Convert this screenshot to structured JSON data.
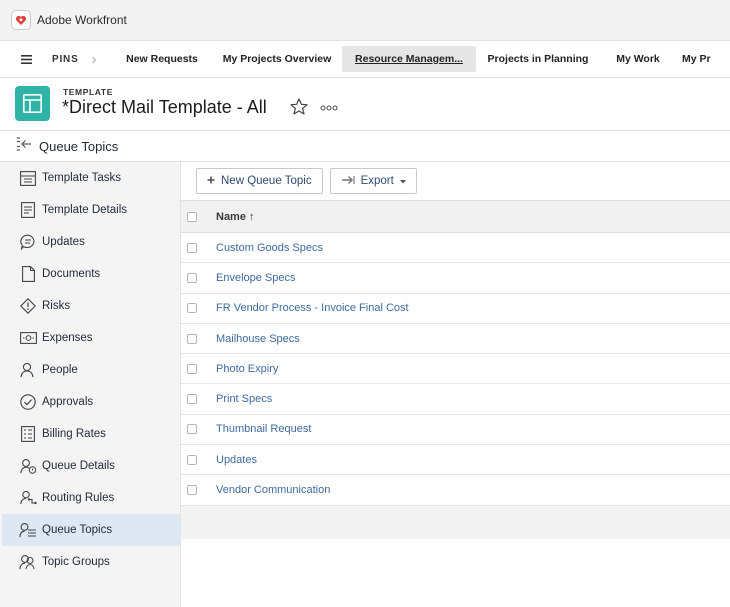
{
  "app": {
    "title": "Adobe Workfront",
    "accent": "#2fb3a6",
    "link_color": "#3d6a9f"
  },
  "nav": {
    "pins_label": "PINS",
    "tabs": [
      {
        "label": "New Requests"
      },
      {
        "label": "My Projects Overview"
      },
      {
        "label": "Resource Managem...",
        "active": true
      },
      {
        "label": "Projects in Planning"
      },
      {
        "label": "My Work"
      },
      {
        "label": "My Pr"
      }
    ]
  },
  "header": {
    "object_type": "TEMPLATE",
    "object_title": "*Direct Mail Template - All",
    "icon": "template-icon"
  },
  "section": {
    "title": "Queue Topics",
    "icon": "collapse-panel-icon"
  },
  "sidebar": {
    "items": [
      {
        "label": "Template Tasks",
        "icon": "tasks-icon"
      },
      {
        "label": "Template Details",
        "icon": "details-icon"
      },
      {
        "label": "Updates",
        "icon": "updates-icon"
      },
      {
        "label": "Documents",
        "icon": "documents-icon"
      },
      {
        "label": "Risks",
        "icon": "risks-icon"
      },
      {
        "label": "Expenses",
        "icon": "expenses-icon"
      },
      {
        "label": "People",
        "icon": "people-icon"
      },
      {
        "label": "Approvals",
        "icon": "approvals-icon"
      },
      {
        "label": "Billing Rates",
        "icon": "billing-rates-icon"
      },
      {
        "label": "Queue Details",
        "icon": "queue-details-icon"
      },
      {
        "label": "Routing Rules",
        "icon": "routing-rules-icon"
      },
      {
        "label": "Queue Topics",
        "icon": "queue-topics-icon",
        "active": true
      },
      {
        "label": "Topic Groups",
        "icon": "topic-groups-icon"
      }
    ]
  },
  "toolbar": {
    "new_label": "New Queue Topic",
    "export_label": "Export"
  },
  "grid": {
    "column_name": "Name",
    "sort_indicator": "↑",
    "rows": [
      "Custom Goods Specs",
      "Envelope Specs",
      "FR Vendor Process - Invoice Final Cost",
      "Mailhouse Specs",
      "Photo Expiry",
      "Print Specs",
      "Thumbnail Request",
      "Updates",
      "Vendor Communication"
    ]
  }
}
